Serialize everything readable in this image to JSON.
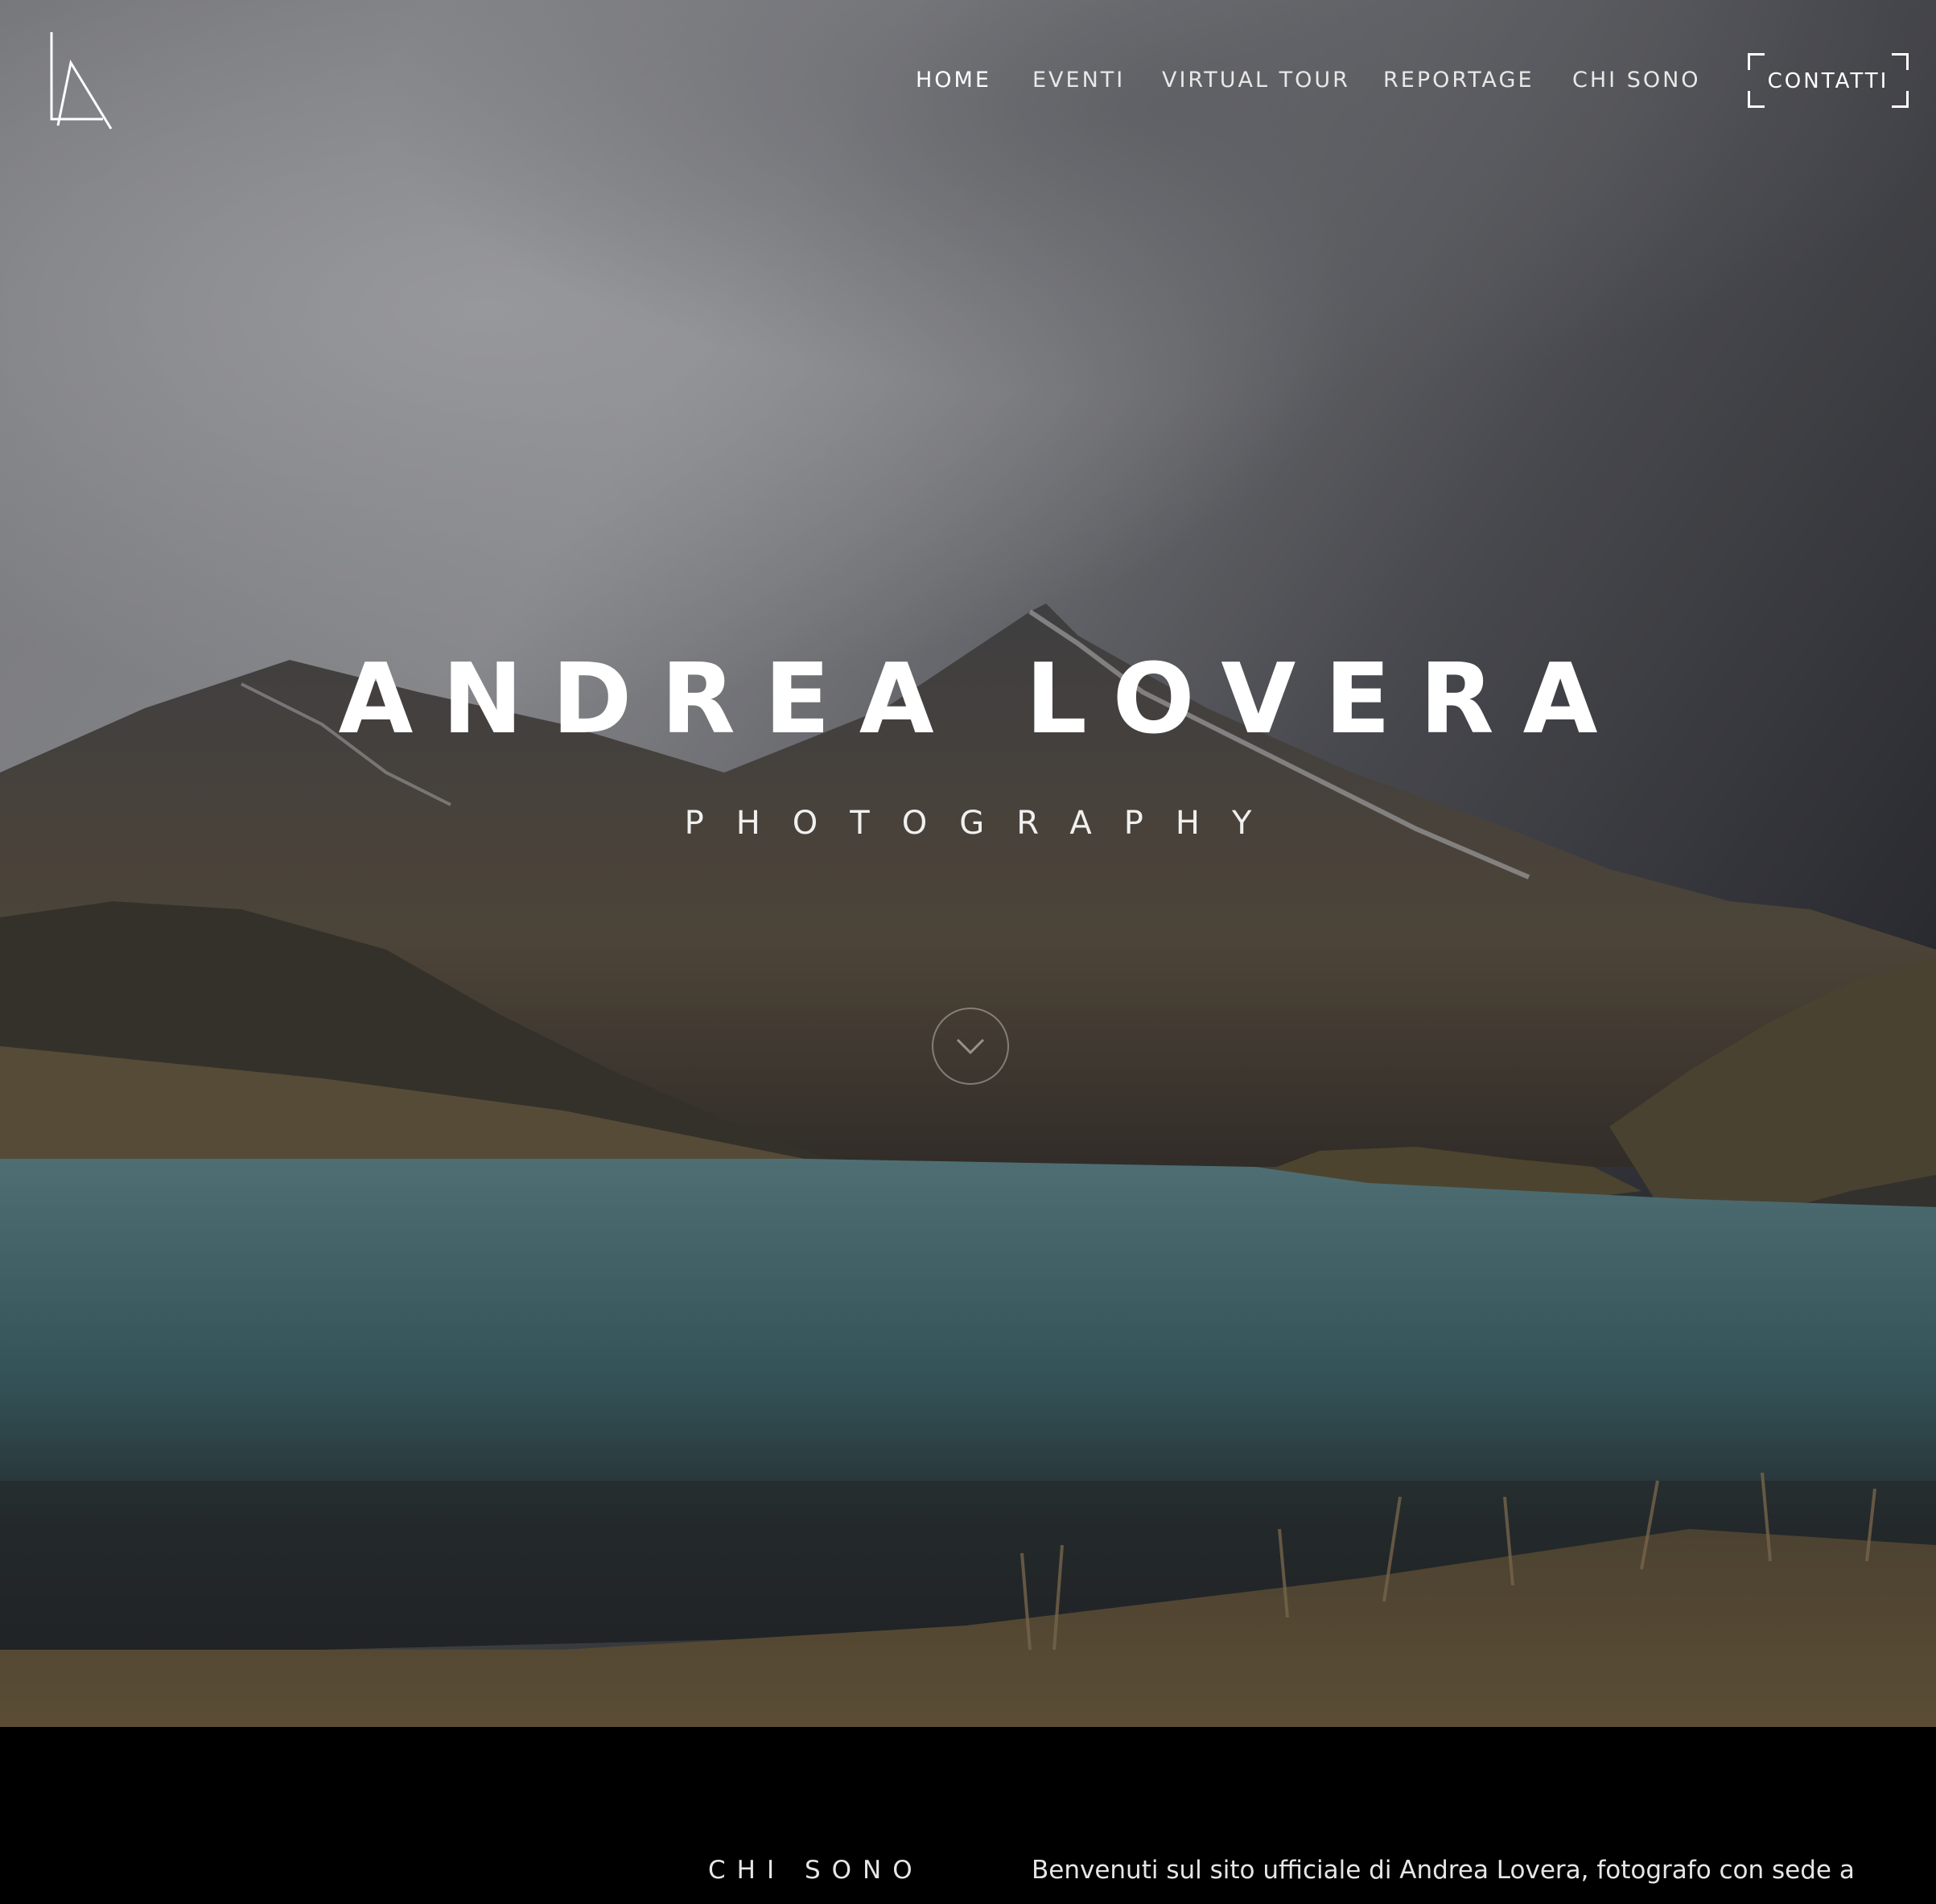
{
  "header": {
    "logo_icon": "monogram-logo",
    "nav": [
      {
        "label": "HOME",
        "active": true
      },
      {
        "label": "EVENTI",
        "active": false
      },
      {
        "label": "VIRTUAL TOUR",
        "active": false
      },
      {
        "label": "REPORTAGE",
        "active": false
      },
      {
        "label": "CHI SONO",
        "active": false
      }
    ],
    "cta_label": "CONTATTI"
  },
  "hero": {
    "title": "ANDREA LOVERA",
    "subtitle": "PHOTOGRAPHY",
    "scroll_icon": "chevron-down-icon"
  },
  "about": {
    "heading": "CHI SONO",
    "intro": "Benvenuti sul sito ufficiale di Andrea Lovera, fotografo con sede a"
  },
  "colors": {
    "background": "#000000",
    "text": "#ffffff",
    "sky": "#5e5f64",
    "lake": "#3f6a70"
  }
}
